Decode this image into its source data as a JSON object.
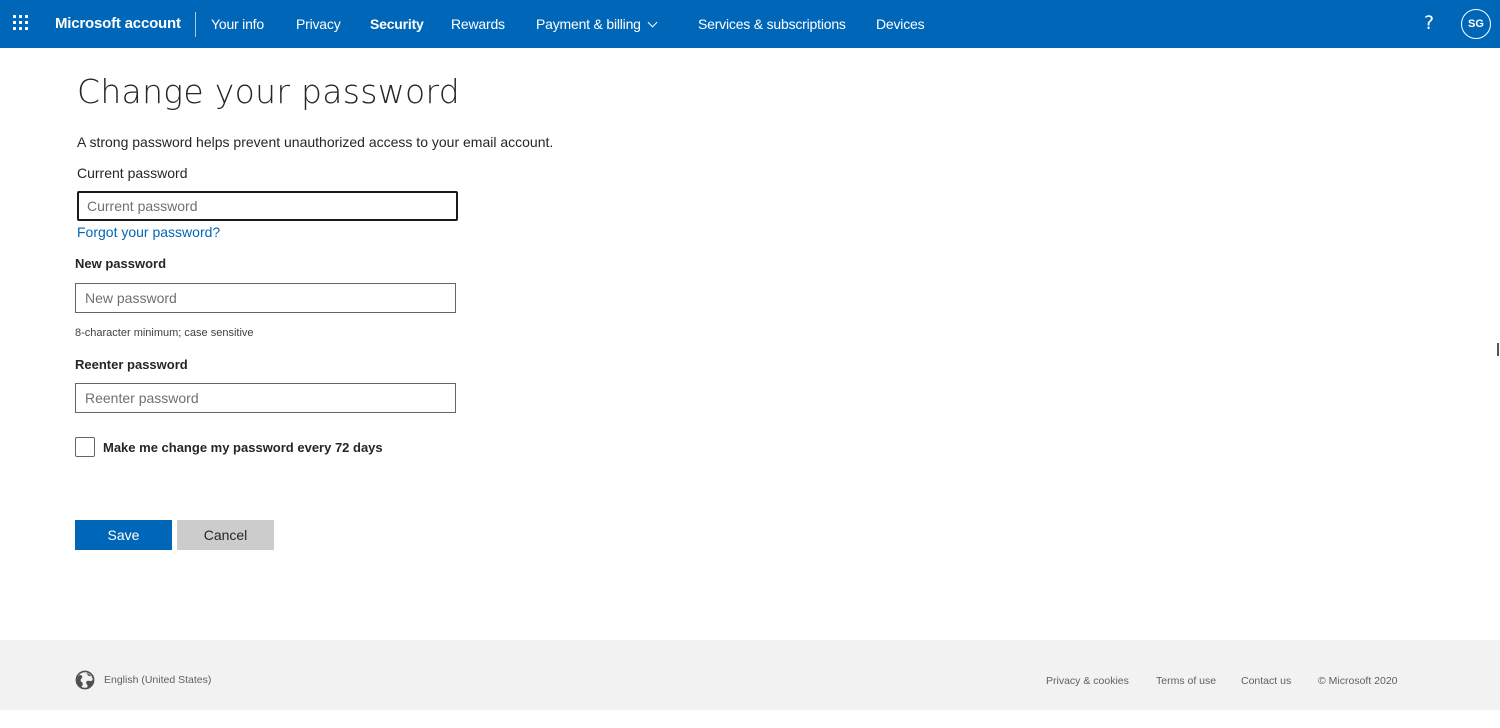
{
  "header": {
    "app_launcher_icon": "waffle-grid-icon",
    "brand": "Microsoft account",
    "nav": [
      {
        "label": "Your info",
        "active": false
      },
      {
        "label": "Privacy",
        "active": false
      },
      {
        "label": "Security",
        "active": true
      },
      {
        "label": "Rewards",
        "active": false
      },
      {
        "label": "Payment & billing",
        "active": false,
        "has_dropdown": true
      },
      {
        "label": "Services & subscriptions",
        "active": false
      },
      {
        "label": "Devices",
        "active": false
      }
    ],
    "help_label": "?",
    "avatar_initials": "SG",
    "bg_color": "#0067b8"
  },
  "main": {
    "title": "Change your password",
    "intro": "A strong password helps prevent unauthorized access to your email account.",
    "current_password": {
      "label": "Current password",
      "placeholder": "Current password",
      "value": ""
    },
    "forgot_link": "Forgot your password?",
    "new_password": {
      "label": "New password",
      "placeholder": "New password",
      "value": "",
      "hint": "8-character minimum; case sensitive"
    },
    "reenter_password": {
      "label": "Reenter password",
      "placeholder": "Reenter password",
      "value": ""
    },
    "expire_checkbox": {
      "label": "Make me change my password every 72 days",
      "checked": false
    },
    "save_label": "Save",
    "cancel_label": "Cancel",
    "accent_color": "#0067b8"
  },
  "footer": {
    "language_icon": "globe-icon",
    "language": "English (United States)",
    "links": [
      "Privacy & cookies",
      "Terms of use",
      "Contact us"
    ],
    "copyright": "© Microsoft 2020"
  }
}
